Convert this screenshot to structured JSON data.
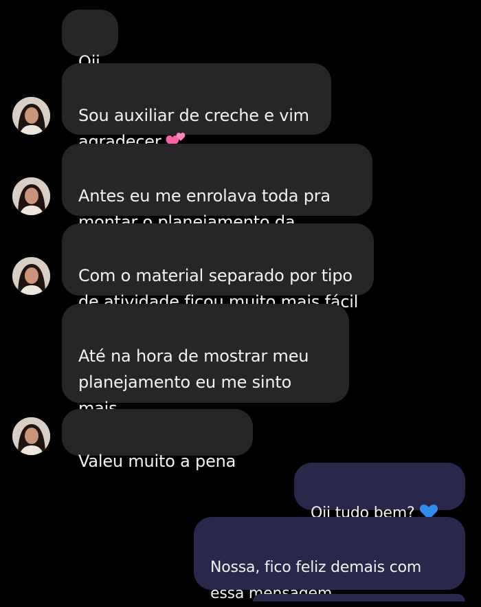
{
  "chat": {
    "incoming": [
      {
        "text": "Oii"
      },
      {
        "text": "Sou auxiliar de creche e vim\nagradecer"
      },
      {
        "text": "Antes eu me enrolava toda pra\nmontar o planejamento da semana"
      },
      {
        "text": "Com o material separado por tipo\nde atividade ficou muito mais fácil"
      },
      {
        "text": "Até na hora de mostrar meu\nplanejamento eu me sinto mais\nsegura"
      },
      {
        "text": "Valeu muito a pena"
      }
    ],
    "outgoing": [
      {
        "text": "Oii tudo bem?"
      },
      {
        "text": "Nossa, fico feliz demais com\nessa mensagem"
      }
    ],
    "emojis": {
      "two_hearts": "two-hearts-icon",
      "blue_heart": "blue-heart-icon"
    }
  },
  "colors": {
    "background": "#000000",
    "incoming_bubble": "#262628",
    "outgoing_bubble": "#27284a",
    "text": "#f2f2f2",
    "blue_heart": "#2f8cf0",
    "pink_heart": "#ff5fa8"
  }
}
